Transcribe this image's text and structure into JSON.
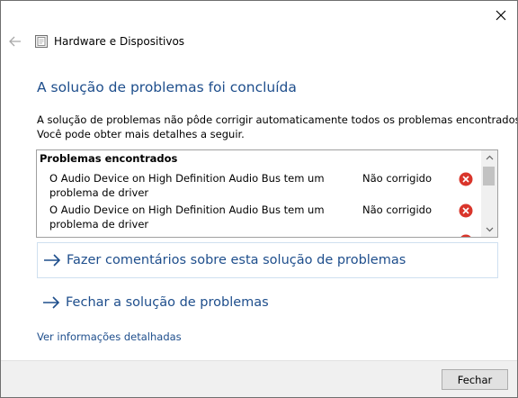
{
  "window": {
    "app_title": "Hardware e Dispositivos",
    "close_icon": "close-icon",
    "back_icon": "back-arrow-icon"
  },
  "main": {
    "heading": "A solução de problemas foi concluída",
    "description_line1": "A solução de problemas não pôde corrigir automaticamente todos os problemas encontrados.",
    "description_line2": "Você pode obter mais detalhes a seguir."
  },
  "problems": {
    "header": "Problemas encontrados",
    "rows": [
      {
        "description_line1": "O Audio Device on High Definition Audio Bus tem um",
        "description_line2": "problema de driver",
        "status": "Não corrigido",
        "icon": "error-icon"
      },
      {
        "description_line1": "O Audio Device on High Definition Audio Bus tem um",
        "description_line2": "problema de driver",
        "status": "Não corrigido",
        "icon": "error-icon"
      }
    ]
  },
  "actions": {
    "feedback": "Fazer comentários sobre esta solução de problemas",
    "close_troubleshooter": "Fechar a solução de problemas"
  },
  "details_link": "Ver informações detalhadas",
  "footer": {
    "close_button": "Fechar"
  },
  "colors": {
    "accent_blue": "#1e4e8c",
    "error_red": "#d9352b"
  }
}
